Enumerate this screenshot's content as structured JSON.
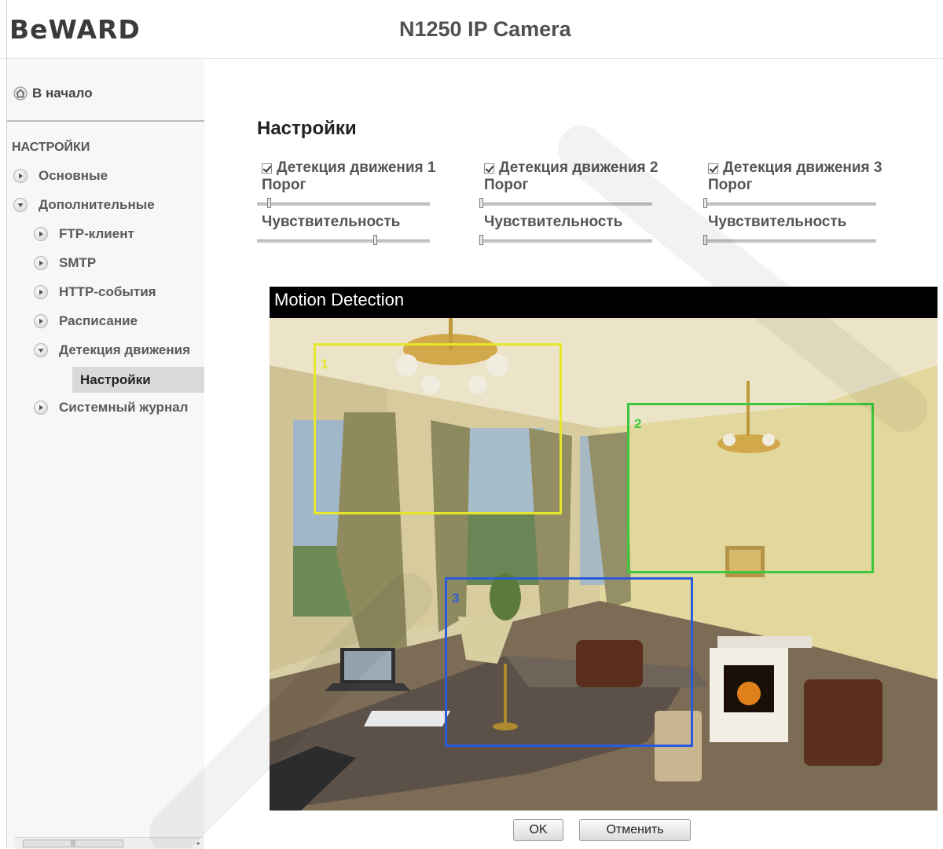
{
  "header": {
    "logo": "BeWARD",
    "title": "N1250 IP Camera"
  },
  "sidebar": {
    "home_label": "В начало",
    "section_title": "НАСТРОЙКИ",
    "items": [
      {
        "label": "Основные",
        "expanded": false
      },
      {
        "label": "Дополнительные",
        "expanded": true
      },
      {
        "label": "FTP-клиент",
        "expanded": false
      },
      {
        "label": "SMTP",
        "expanded": false
      },
      {
        "label": "HTTP-события",
        "expanded": false
      },
      {
        "label": "Расписание",
        "expanded": false
      },
      {
        "label": "Детекция движения",
        "expanded": true
      },
      {
        "label": "Системный журнал",
        "expanded": false
      }
    ],
    "active_item": "Настройки"
  },
  "main": {
    "title": "Настройки",
    "detectors": [
      {
        "label": "Детекция движения 1",
        "checked": true,
        "threshold_label": "Порог",
        "threshold": 0.06,
        "sensitivity_label": "Чувствительность",
        "sensitivity": 0.69
      },
      {
        "label": "Детекция движения 2",
        "checked": true,
        "threshold_label": "Порог",
        "threshold": 0.0,
        "sensitivity_label": "Чувствительность",
        "sensitivity": 0.0
      },
      {
        "label": "Детекция движения 3",
        "checked": true,
        "threshold_label": "Порог",
        "threshold": 0.0,
        "sensitivity_label": "Чувствительность",
        "sensitivity": 0.0
      }
    ],
    "video": {
      "title": "Motion Detection",
      "zones": [
        {
          "number": "1",
          "color": "#e6e62a"
        },
        {
          "number": "2",
          "color": "#3cc83c"
        },
        {
          "number": "3",
          "color": "#2a5adc"
        }
      ]
    },
    "ok_label": "OK",
    "cancel_label": "Отменить"
  },
  "icons": {
    "home": "home-icon",
    "expand": "arrow-right-icon",
    "collapse": "arrow-down-icon",
    "checkbox": "checkbox-icon"
  }
}
